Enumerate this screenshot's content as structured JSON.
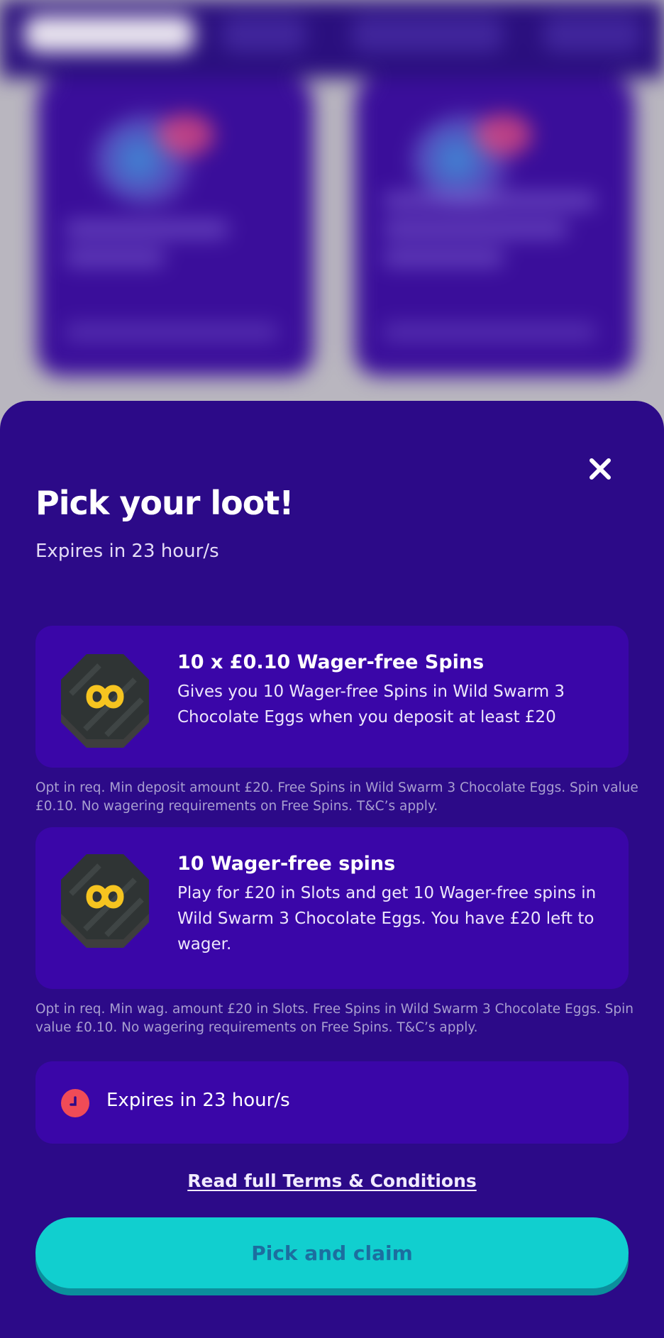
{
  "colors": {
    "sheet_bg": "#2c0a88",
    "card_bg": "#3a06a8",
    "accent_cta": "#11cfcf",
    "cta_text": "#1c6e9f",
    "clock_red": "#f04b57",
    "coin_gold": "#f6c420"
  },
  "sheet": {
    "close_icon": "close-icon",
    "title": "Pick your loot!",
    "subtitle": "Expires in 23 hour/s"
  },
  "offers": [
    {
      "icon": "infinity-coin-icon",
      "title": "10 x £0.10 Wager-free Spins",
      "description": "Gives you 10 Wager-free Spins in Wild Swarm 3 Chocolate Eggs when you deposit at least £20",
      "disclaimer": "Opt in req. Min deposit amount £20. Free Spins in Wild Swarm 3 Chocolate Eggs. Spin value £0.10. No wagering requirements on Free Spins. T&C’s apply."
    },
    {
      "icon": "infinity-coin-icon",
      "title": "10 Wager-free spins",
      "description": "Play for £20 in Slots and get 10 Wager-free spins in Wild Swarm 3 Chocolate Eggs. You have £20 left to wager.",
      "disclaimer": "Opt in req. Min wag. amount £20 in Slots. Free Spins in Wild Swarm 3 Chocolate Eggs. Spin value £0.10. No wagering requirements on Free Spins. T&C’s apply."
    }
  ],
  "expiry": {
    "icon": "clock-icon",
    "text": "Expires in 23 hour/s"
  },
  "terms_link": "Read full Terms & Conditions",
  "cta_label": "Pick and claim"
}
